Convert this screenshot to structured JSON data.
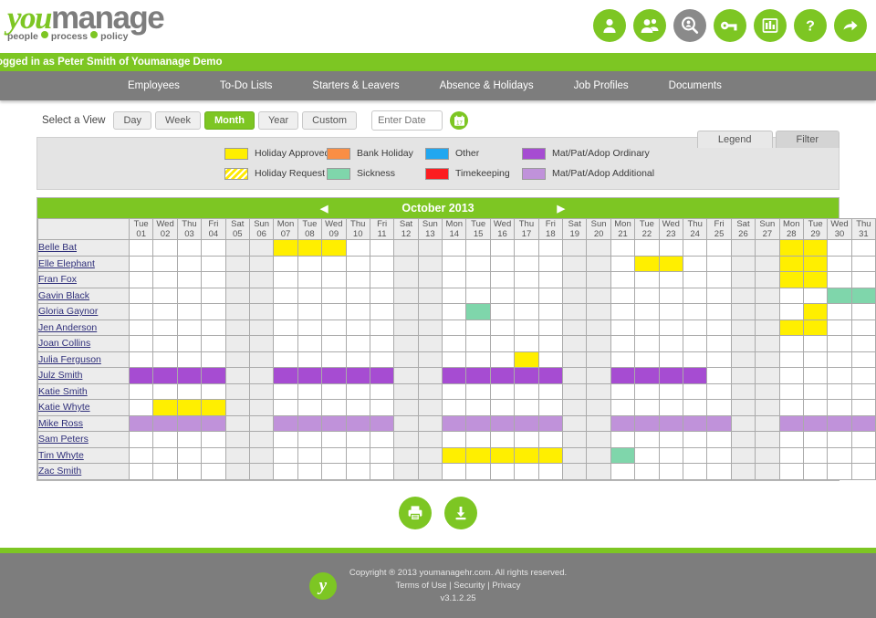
{
  "brand": {
    "name_you": "you",
    "name_manage": "manage",
    "tagline_1": "people",
    "tagline_2": "process",
    "tagline_3": "policy",
    "green": "#7dc623",
    "grey": "#7d7d7d"
  },
  "header": {
    "icons": [
      {
        "name": "person-icon",
        "active": false
      },
      {
        "name": "people-icon",
        "active": false
      },
      {
        "name": "search-icon",
        "active": true
      },
      {
        "name": "key-icon",
        "active": false
      },
      {
        "name": "reports-icon",
        "active": false
      },
      {
        "name": "help-icon",
        "active": false
      },
      {
        "name": "share-icon",
        "active": false
      }
    ]
  },
  "login_bar": {
    "text": "ogged in as Peter Smith of Youmanage Demo"
  },
  "nav": {
    "items": [
      "Employees",
      "To-Do Lists",
      "Starters & Leavers",
      "Absence & Holidays",
      "Job Profiles",
      "Documents"
    ]
  },
  "view_selector": {
    "label": "Select a View",
    "buttons": [
      {
        "label": "Day",
        "active": false
      },
      {
        "label": "Week",
        "active": false
      },
      {
        "label": "Month",
        "active": true
      },
      {
        "label": "Year",
        "active": false
      },
      {
        "label": "Custom",
        "active": false
      }
    ],
    "date_placeholder": "Enter Date",
    "date_value": "",
    "calendar_icon": "calendar-icon"
  },
  "tabs": [
    {
      "label": "Legend",
      "active": false
    },
    {
      "label": "Filter",
      "active": true
    }
  ],
  "legend": {
    "items": [
      {
        "label": "Holiday Approved",
        "color": "#ffef00",
        "striped": false
      },
      {
        "label": "Holiday Request",
        "color": "#ffef00",
        "striped": true
      },
      {
        "label": "Bank Holiday",
        "color": "#f98e45",
        "striped": false
      },
      {
        "label": "Sickness",
        "color": "#7fd6ab",
        "striped": false
      },
      {
        "label": "Other",
        "color": "#21a7f0",
        "striped": false
      },
      {
        "label": "Timekeeping",
        "color": "#fc1d20",
        "striped": false
      },
      {
        "label": "Mat/Pat/Adop Ordinary",
        "color": "#a64cd2",
        "striped": false
      },
      {
        "label": "Mat/Pat/Adop Additional",
        "color": "#c092da",
        "striped": false
      }
    ]
  },
  "calendar": {
    "title": "October 2013",
    "prev_arrow": "◀",
    "next_arrow": "▶",
    "days": [
      {
        "dow": "Tue",
        "num": "01",
        "weekend": false
      },
      {
        "dow": "Wed",
        "num": "02",
        "weekend": false
      },
      {
        "dow": "Thu",
        "num": "03",
        "weekend": false
      },
      {
        "dow": "Fri",
        "num": "04",
        "weekend": false
      },
      {
        "dow": "Sat",
        "num": "05",
        "weekend": true
      },
      {
        "dow": "Sun",
        "num": "06",
        "weekend": true
      },
      {
        "dow": "Mon",
        "num": "07",
        "weekend": false
      },
      {
        "dow": "Tue",
        "num": "08",
        "weekend": false
      },
      {
        "dow": "Wed",
        "num": "09",
        "weekend": false
      },
      {
        "dow": "Thu",
        "num": "10",
        "weekend": false
      },
      {
        "dow": "Fri",
        "num": "11",
        "weekend": false
      },
      {
        "dow": "Sat",
        "num": "12",
        "weekend": true
      },
      {
        "dow": "Sun",
        "num": "13",
        "weekend": true
      },
      {
        "dow": "Mon",
        "num": "14",
        "weekend": false
      },
      {
        "dow": "Tue",
        "num": "15",
        "weekend": false
      },
      {
        "dow": "Wed",
        "num": "16",
        "weekend": false
      },
      {
        "dow": "Thu",
        "num": "17",
        "weekend": false
      },
      {
        "dow": "Fri",
        "num": "18",
        "weekend": false
      },
      {
        "dow": "Sat",
        "num": "19",
        "weekend": true
      },
      {
        "dow": "Sun",
        "num": "20",
        "weekend": true
      },
      {
        "dow": "Mon",
        "num": "21",
        "weekend": false
      },
      {
        "dow": "Tue",
        "num": "22",
        "weekend": false
      },
      {
        "dow": "Wed",
        "num": "23",
        "weekend": false
      },
      {
        "dow": "Thu",
        "num": "24",
        "weekend": false
      },
      {
        "dow": "Fri",
        "num": "25",
        "weekend": false
      },
      {
        "dow": "Sat",
        "num": "26",
        "weekend": true
      },
      {
        "dow": "Sun",
        "num": "27",
        "weekend": true
      },
      {
        "dow": "Mon",
        "num": "28",
        "weekend": false
      },
      {
        "dow": "Tue",
        "num": "29",
        "weekend": false
      },
      {
        "dow": "Wed",
        "num": "30",
        "weekend": false
      },
      {
        "dow": "Thu",
        "num": "31",
        "weekend": false
      }
    ],
    "rows": [
      {
        "name": "Belle Bat",
        "entries": [
          {
            "from": 7,
            "to": 9,
            "type": "Holiday Approved",
            "color": "#ffef00"
          },
          {
            "from": 28,
            "to": 29,
            "type": "Holiday Approved",
            "color": "#ffef00"
          }
        ]
      },
      {
        "name": "Elle Elephant",
        "entries": [
          {
            "from": 22,
            "to": 23,
            "type": "Holiday Approved",
            "color": "#ffef00"
          },
          {
            "from": 28,
            "to": 29,
            "type": "Holiday Approved",
            "color": "#ffef00"
          }
        ]
      },
      {
        "name": "Fran Fox",
        "entries": [
          {
            "from": 28,
            "to": 29,
            "type": "Holiday Approved",
            "color": "#ffef00"
          }
        ]
      },
      {
        "name": "Gavin Black",
        "entries": [
          {
            "from": 30,
            "to": 30,
            "type": "Sickness",
            "color": "#7fd6ab"
          },
          {
            "from": 31,
            "to": 31,
            "type": "Sickness",
            "color": "#7fd6ab"
          }
        ]
      },
      {
        "name": "Gloria Gaynor",
        "entries": [
          {
            "from": 15,
            "to": 15,
            "type": "Sickness",
            "color": "#7fd6ab"
          },
          {
            "from": 29,
            "to": 29,
            "type": "Holiday Approved",
            "color": "#ffef00"
          }
        ]
      },
      {
        "name": "Jen Anderson",
        "entries": [
          {
            "from": 28,
            "to": 29,
            "type": "Holiday Approved",
            "color": "#ffef00"
          }
        ]
      },
      {
        "name": "Joan Collins",
        "entries": []
      },
      {
        "name": "Julia Ferguson",
        "entries": [
          {
            "from": 17,
            "to": 17,
            "type": "Holiday Approved",
            "color": "#ffef00"
          }
        ]
      },
      {
        "name": "Julz Smith",
        "entries": [
          {
            "from": 1,
            "to": 4,
            "type": "Mat/Pat/Adop Ordinary",
            "color": "#a64cd2"
          },
          {
            "from": 7,
            "to": 11,
            "type": "Mat/Pat/Adop Ordinary",
            "color": "#a64cd2"
          },
          {
            "from": 14,
            "to": 18,
            "type": "Mat/Pat/Adop Ordinary",
            "color": "#a64cd2"
          },
          {
            "from": 21,
            "to": 24,
            "type": "Mat/Pat/Adop Ordinary",
            "color": "#a64cd2"
          }
        ]
      },
      {
        "name": "Katie Smith",
        "entries": []
      },
      {
        "name": "Katie Whyte",
        "entries": [
          {
            "from": 2,
            "to": 2,
            "type": "Holiday Approved",
            "color": "#ffef00"
          },
          {
            "from": 3,
            "to": 4,
            "type": "Holiday Approved",
            "color": "#ffef00"
          }
        ]
      },
      {
        "name": "Mike Ross",
        "entries": [
          {
            "from": 1,
            "to": 4,
            "type": "Mat/Pat/Adop Additional",
            "color": "#c092da"
          },
          {
            "from": 7,
            "to": 11,
            "type": "Mat/Pat/Adop Additional",
            "color": "#c092da"
          },
          {
            "from": 14,
            "to": 18,
            "type": "Mat/Pat/Adop Additional",
            "color": "#c092da"
          },
          {
            "from": 21,
            "to": 25,
            "type": "Mat/Pat/Adop Additional",
            "color": "#c092da"
          },
          {
            "from": 28,
            "to": 31,
            "type": "Mat/Pat/Adop Additional",
            "color": "#c092da"
          }
        ]
      },
      {
        "name": "Sam Peters",
        "entries": []
      },
      {
        "name": "Tim Whyte",
        "entries": [
          {
            "from": 14,
            "to": 18,
            "type": "Holiday Approved",
            "color": "#ffef00"
          },
          {
            "from": 21,
            "to": 21,
            "type": "Sickness",
            "color": "#7fd6ab"
          }
        ]
      },
      {
        "name": "Zac Smith",
        "entries": []
      }
    ]
  },
  "actions": [
    {
      "name": "print-button",
      "icon": "printer-icon"
    },
    {
      "name": "download-button",
      "icon": "download-icon"
    }
  ],
  "footer": {
    "copyright": "Copyright ® 2013 youmanagehr.com. All rights reserved.",
    "links": "Terms of Use | Security | Privacy",
    "version": "v3.1.2.25",
    "logo_letter": "y"
  }
}
